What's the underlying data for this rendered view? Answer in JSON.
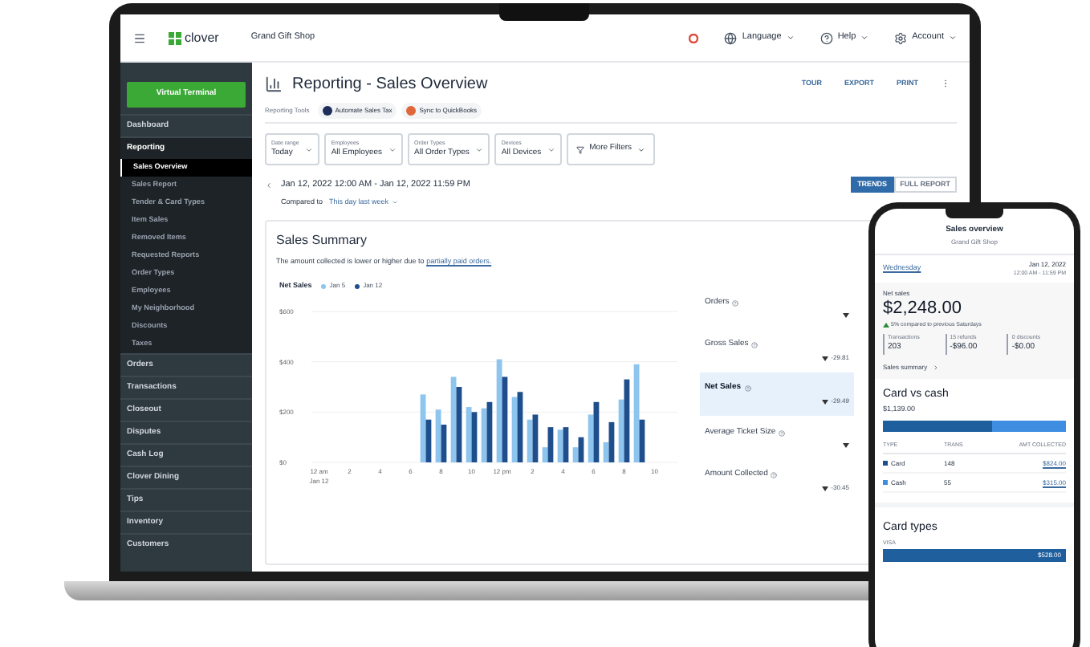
{
  "app_header": {
    "logo_text": "clover",
    "shop_name": "Grand Gift Shop",
    "menus": [
      {
        "label": "Language",
        "kind": "globe"
      },
      {
        "label": "Help",
        "kind": "help"
      },
      {
        "label": "Account",
        "kind": "gear"
      }
    ]
  },
  "sidebar": {
    "button": "Virtual Terminal",
    "items": [
      {
        "label": "Dashboard",
        "selected": false
      },
      {
        "label": "Reporting",
        "selected": false,
        "expanded": true,
        "children": [
          {
            "label": "Sales Overview",
            "selected": true
          },
          {
            "label": "Sales Report",
            "selected": false
          },
          {
            "label": "Tender & Card Types",
            "selected": false
          },
          {
            "label": "Item Sales",
            "selected": false
          },
          {
            "label": "Removed Items",
            "selected": false
          },
          {
            "label": "Requested Reports",
            "selected": false
          },
          {
            "label": "Order Types",
            "selected": false
          },
          {
            "label": "Employees",
            "selected": false
          },
          {
            "label": "My Neighborhood",
            "selected": false
          },
          {
            "label": "Discounts",
            "selected": false
          },
          {
            "label": "Taxes",
            "selected": false
          }
        ]
      },
      {
        "label": "Orders",
        "selected": false
      },
      {
        "label": "Transactions",
        "selected": false
      },
      {
        "label": "Closeout",
        "selected": false
      },
      {
        "label": "Disputes",
        "selected": false
      },
      {
        "label": "Cash Log",
        "selected": false
      },
      {
        "label": "Clover Dining",
        "selected": false
      },
      {
        "label": "Tips",
        "selected": false
      },
      {
        "label": "Inventory",
        "selected": false
      },
      {
        "label": "Customers",
        "selected": false
      }
    ]
  },
  "page": {
    "title": "Reporting - Sales Overview",
    "actions": [
      "TOUR",
      "EXPORT",
      "PRINT"
    ],
    "tools_label": "Reporting Tools",
    "tools": [
      {
        "label": "Automate Sales Tax",
        "color": "#1f2d5a"
      },
      {
        "label": "Sync to QuickBooks",
        "color": "#e0673a"
      }
    ],
    "filters": [
      {
        "label": "Date range",
        "value": "Today"
      },
      {
        "label": "Employees",
        "value": "All Employees"
      },
      {
        "label": "Order Types",
        "value": "All Order Types"
      },
      {
        "label": "Devices",
        "value": "All Devices"
      }
    ],
    "more_filters": "More Filters",
    "date_range": "Jan 12, 2022 12:00 AM - Jan 12, 2022 11:59 PM",
    "view_tabs": [
      {
        "label": "TRENDS",
        "selected": true
      },
      {
        "label": "FULL REPORT",
        "selected": false
      }
    ],
    "compared_label": "Compared to",
    "compared_value": "This day last week"
  },
  "summary": {
    "title": "Sales Summary",
    "note": "The amount collected is lower or higher due to ",
    "note_link": "partially paid orders.",
    "chart_data": {
      "type": "bar",
      "title": "Net Sales",
      "xlabel": "Jan 12",
      "categories": [
        "12 am",
        null,
        "2",
        null,
        "4",
        null,
        "6",
        null,
        "8",
        null,
        "10",
        null,
        "12 pm",
        null,
        "2",
        null,
        "4",
        null,
        "6",
        null,
        "8",
        null,
        "10",
        null
      ],
      "series": [
        {
          "name": "Jan 5",
          "color": "#8ec5ef",
          "values": [
            null,
            null,
            null,
            null,
            null,
            null,
            null,
            270,
            210,
            340,
            220,
            215,
            410,
            260,
            170,
            60,
            130,
            60,
            190,
            80,
            250,
            390,
            null,
            null
          ]
        },
        {
          "name": "Jan 12",
          "color": "#1f4e8c",
          "values": [
            null,
            null,
            null,
            null,
            null,
            null,
            null,
            170,
            150,
            300,
            200,
            240,
            340,
            280,
            190,
            140,
            140,
            100,
            240,
            160,
            330,
            170,
            null,
            null
          ]
        }
      ],
      "ylim": [
        0,
        600
      ],
      "yticks": [
        {
          "value": 0,
          "label": "$0"
        },
        {
          "value": 200,
          "label": "$200"
        },
        {
          "value": 400,
          "label": "$400"
        },
        {
          "value": 600,
          "label": "$600"
        }
      ],
      "stacked": false,
      "legend": "top"
    },
    "metrics": [
      {
        "label": "Orders",
        "selected": false
      },
      {
        "label": "Gross Sales",
        "change": "-29.81",
        "selected": false
      },
      {
        "label": "Net Sales",
        "change": "-29.49",
        "selected": true
      },
      {
        "label": "Average Ticket Size",
        "selected": false
      },
      {
        "label": "Amount Collected",
        "change": "-30.45",
        "selected": false
      }
    ]
  },
  "phone": {
    "title": "Sales overview",
    "subtitle": "Grand Gift Shop",
    "day": "Wednesday",
    "date": "Jan 12, 2022",
    "time": "12:00 AM - 11:59 PM",
    "net_label": "Net sales",
    "net_value": "$2,248.00",
    "net_compare": "5% compared to previous Saturdays",
    "stats": [
      {
        "label": "Transactions",
        "value": "203"
      },
      {
        "label": "15 refunds",
        "value": "-$96.00"
      },
      {
        "label": "0 discounts",
        "value": "-$0.00"
      }
    ],
    "summary_link": "Sales summary",
    "card_cash_title": "Card vs cash",
    "card_cash_total": "$1,139.00",
    "card_share": {
      "level": 0.6
    },
    "columns": [
      "TYPE",
      "TRANS",
      "AMT COLLECTED"
    ],
    "rows": [
      {
        "type": "Card",
        "trans": "148",
        "amount": "$824.00",
        "color": "#1f4e8c"
      },
      {
        "type": "Cash",
        "trans": "55",
        "amount": "$315.00",
        "color": "#3d8ee0"
      }
    ],
    "card_types_title": "Card types",
    "card_type": "VISA",
    "card_type_amount": "$528.00"
  }
}
